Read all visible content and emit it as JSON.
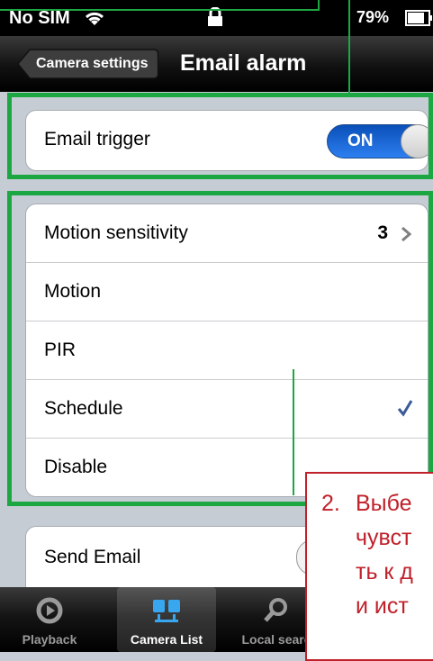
{
  "status_bar": {
    "carrier": "No SIM",
    "battery": "79%"
  },
  "nav_bar": {
    "back_label": "Camera settings",
    "title": "Email alarm"
  },
  "email_trigger": {
    "label": "Email trigger",
    "toggle_text": "ON",
    "toggle_state": "on"
  },
  "alarm_options": {
    "rows": [
      {
        "label": "Motion sensitivity",
        "value": "3"
      },
      {
        "label": "Motion"
      },
      {
        "label": "PIR"
      },
      {
        "label": "Schedule"
      },
      {
        "label": "Disable"
      }
    ],
    "selected": "Schedule"
  },
  "send_email": {
    "label": "Send Email"
  },
  "tab_bar": {
    "tabs": [
      {
        "label": "Playback",
        "icon": "playback-icon"
      },
      {
        "label": "Camera List",
        "icon": "camera-list-icon",
        "active": true
      },
      {
        "label": "Local searc",
        "icon": "search-icon"
      }
    ]
  },
  "annotation": {
    "number": "2.",
    "lines": [
      "Выбе",
      "чувст",
      "ть к д",
      "и ист"
    ]
  },
  "colors": {
    "annotation_green": "#1da743",
    "annotation_red": "#c0202a",
    "toggle_blue": "#2d7ff1",
    "checkmark": "#3a5a98"
  }
}
